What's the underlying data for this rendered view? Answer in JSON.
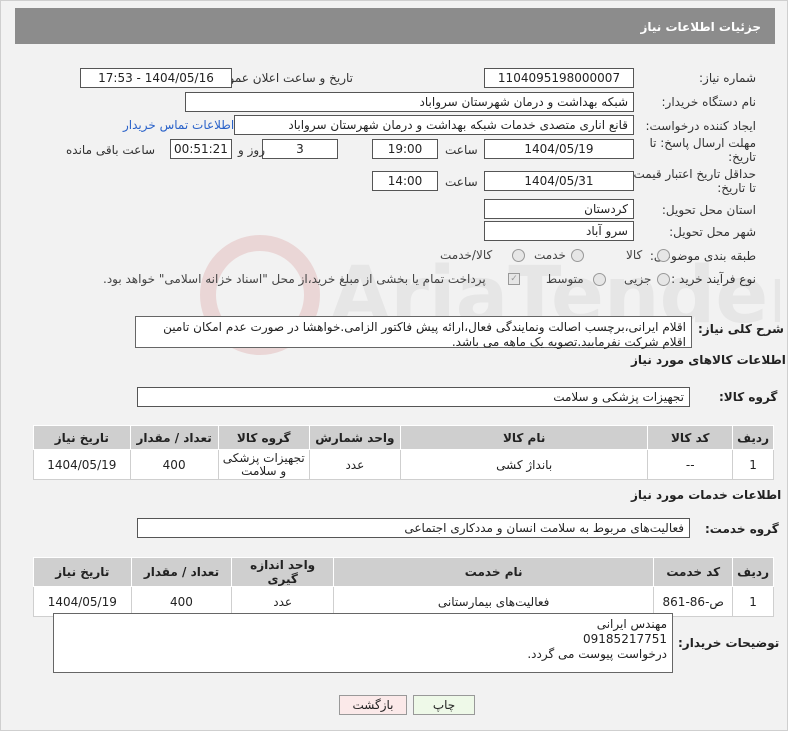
{
  "header": {
    "title": "جزئیات اطلاعات نیاز"
  },
  "fields": {
    "need_number_label": "شماره نیاز:",
    "need_number": "1104095198000007",
    "announce_label": "تاریخ و ساعت اعلان عمومی:",
    "announce_value": "1404/05/16 - 17:53",
    "buyer_label": "نام دستگاه خریدار:",
    "buyer_value": "شبکه بهداشت و درمان شهرستان سرواباد",
    "creator_label": "ایجاد کننده درخواست:",
    "creator_value": "قانع اناری متصدی خدمات شبکه بهداشت و درمان شهرستان سرواباد",
    "contact_link": "اطلاعات تماس خریدار",
    "deadline_label": "مهلت ارسال پاسخ: تا تاریخ:",
    "deadline_date": "1404/05/19",
    "time_label": "ساعت",
    "deadline_time": "19:00",
    "days_value": "3",
    "days_label": "روز و",
    "remaining_time": "00:51:21",
    "remaining_label": "ساعت باقی مانده",
    "validity_label": "حداقل تاریخ اعتبار قیمت: تا تاریخ:",
    "validity_date": "1404/05/31",
    "validity_time": "14:00",
    "province_label": "استان محل تحویل:",
    "province_value": "کردستان",
    "city_label": "شهر محل تحویل:",
    "city_value": "سرو آباد",
    "category_label": "طبقه بندی موضوعی:",
    "category_options": [
      "کالا",
      "خدمت",
      "کالا/خدمت"
    ],
    "process_label": "نوع فرآیند خرید :",
    "process_options": [
      "جزیی",
      "متوسط"
    ],
    "process_note": "پرداخت تمام یا بخشی از مبلغ خرید،از محل \"اسناد خزانه اسلامی\" خواهد بود."
  },
  "description": {
    "label": "شرح کلی نیاز:",
    "text": "اقلام ایرانی،برچسب اصالت ونمایندگی فعال،ارائه پیش فاکتور الزامی.خواهشا در صورت عدم امکان تامین اقلام شرکت نفرمایید.تصویه یک ماهه می باشد."
  },
  "goods": {
    "section_title": "اطلاعات کالاهای مورد نیاز",
    "group_label": "گروه کالا:",
    "group_value": "تجهیزات پزشکی و سلامت",
    "columns": [
      "ردیف",
      "کد کالا",
      "نام کالا",
      "واحد شمارش",
      "گروه کالا",
      "تعداد / مقدار",
      "تاریخ نیاز"
    ],
    "rows": [
      [
        "1",
        "--",
        "بانداژ کشی",
        "عدد",
        "تجهیزات پزشکی و سلامت",
        "400",
        "1404/05/19"
      ]
    ]
  },
  "services": {
    "section_title": "اطلاعات خدمات مورد نیاز",
    "group_label": "گروه خدمت:",
    "group_value": "فعالیت‌های مربوط به سلامت انسان و مددکاری اجتماعی",
    "columns": [
      "ردیف",
      "کد خدمت",
      "نام خدمت",
      "واحد اندازه گیری",
      "تعداد / مقدار",
      "تاریخ نیاز"
    ],
    "rows": [
      [
        "1",
        "ص-86-861",
        "فعالیت‌های بیمارستانی",
        "عدد",
        "400",
        "1404/05/19"
      ]
    ]
  },
  "buyer_notes": {
    "label": "توضیحات خریدار:",
    "lines": [
      "مهندس ایرانی",
      "09185217751",
      "درخواست پیوست می گردد."
    ]
  },
  "buttons": {
    "print": "چاپ",
    "back": "بازگشت"
  },
  "watermark": {
    "brand_text": "AriaTender.neT"
  }
}
